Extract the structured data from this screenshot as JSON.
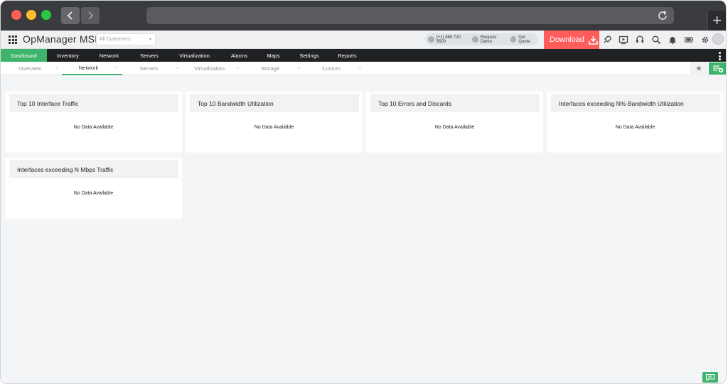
{
  "app": {
    "brand": "OpManager MSP",
    "customer_select": "All Customers",
    "contact": {
      "phone": "(+1) 888 720 9500",
      "request_demo": "Request Demo",
      "get_quote": "Get Quote"
    },
    "download_label": "Download"
  },
  "header_icons": [
    "rocket-icon",
    "video-icon",
    "headset-icon",
    "search-icon",
    "bell-icon",
    "battery-icon",
    "gear-icon",
    "avatar"
  ],
  "main_nav": [
    {
      "label": "Dashboard",
      "active": true
    },
    {
      "label": "Inventory"
    },
    {
      "label": "Network"
    },
    {
      "label": "Servers"
    },
    {
      "label": "Virtualization"
    },
    {
      "label": "Alarms"
    },
    {
      "label": "Maps"
    },
    {
      "label": "Settings"
    },
    {
      "label": "Reports"
    }
  ],
  "sub_nav": [
    {
      "label": "Overview"
    },
    {
      "label": "Network",
      "active": true
    },
    {
      "label": "Servers"
    },
    {
      "label": "Virtualization"
    },
    {
      "label": "Storage"
    },
    {
      "label": "Custom"
    }
  ],
  "widgets": [
    {
      "title": "Top 10 Interface Traffic",
      "message": "No Data Available"
    },
    {
      "title": "Top 10 Bandwidth Utilization",
      "message": "No Data Available"
    },
    {
      "title": "Top 10 Errors and Discards",
      "message": "No Data Available"
    },
    {
      "title": "Interfaces exceeding N% Bandwidth Utilization",
      "message": "No Data Available"
    },
    {
      "title": "Interfaces exceeding N Mbps Traffic",
      "message": "No Data Available"
    }
  ],
  "colors": {
    "accent": "#3eb36b",
    "download": "#ff5c5c",
    "nav_bg": "#1f2123"
  }
}
